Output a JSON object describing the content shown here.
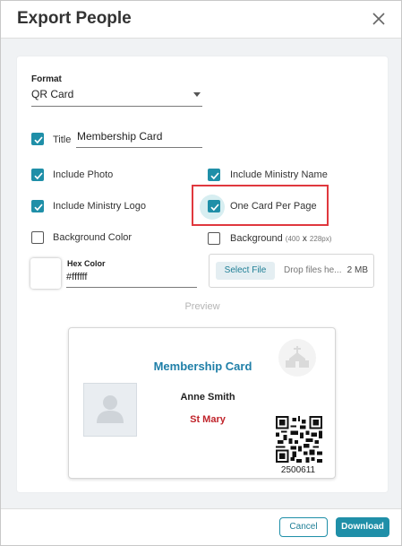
{
  "dialog": {
    "title": "Export People"
  },
  "form": {
    "format_label": "Format",
    "format_value": "QR Card",
    "title_checkbox_label": "Title",
    "title_value": "Membership Card",
    "options": {
      "include_photo": {
        "label": "Include Photo",
        "checked": true
      },
      "include_ministry_name": {
        "label": "Include Ministry Name",
        "checked": true
      },
      "include_ministry_logo": {
        "label": "Include Ministry Logo",
        "checked": true
      },
      "one_card_per_page": {
        "label": "One Card Per Page",
        "checked": true
      },
      "background_color": {
        "label": "Background Color",
        "checked": false
      },
      "background": {
        "label": "Background",
        "checked": false,
        "dims_w": "(400",
        "dims_x": "x",
        "dims_h": "228px)"
      }
    },
    "hex_color_label": "Hex Color",
    "hex_color_value": "#ffffff",
    "upload": {
      "button_label": "Select File",
      "drop_text": "Drop files he...",
      "max_size": "2 MB"
    }
  },
  "preview": {
    "label": "Preview",
    "card_title": "Membership Card",
    "person_name": "Anne Smith",
    "ministry": "St Mary",
    "member_number": "2500611"
  },
  "footer": {
    "cancel_label": "Cancel",
    "download_label": "Download"
  },
  "colors": {
    "accent": "#1f8fa8",
    "highlight": "#e0383e",
    "ministry_text": "#c0242b"
  },
  "icons": {
    "close": "close-icon",
    "check": "checkmark-icon",
    "caret": "chevron-down-icon",
    "logo": "church-icon",
    "photo": "person-placeholder-icon",
    "qr": "qr-code-icon"
  }
}
